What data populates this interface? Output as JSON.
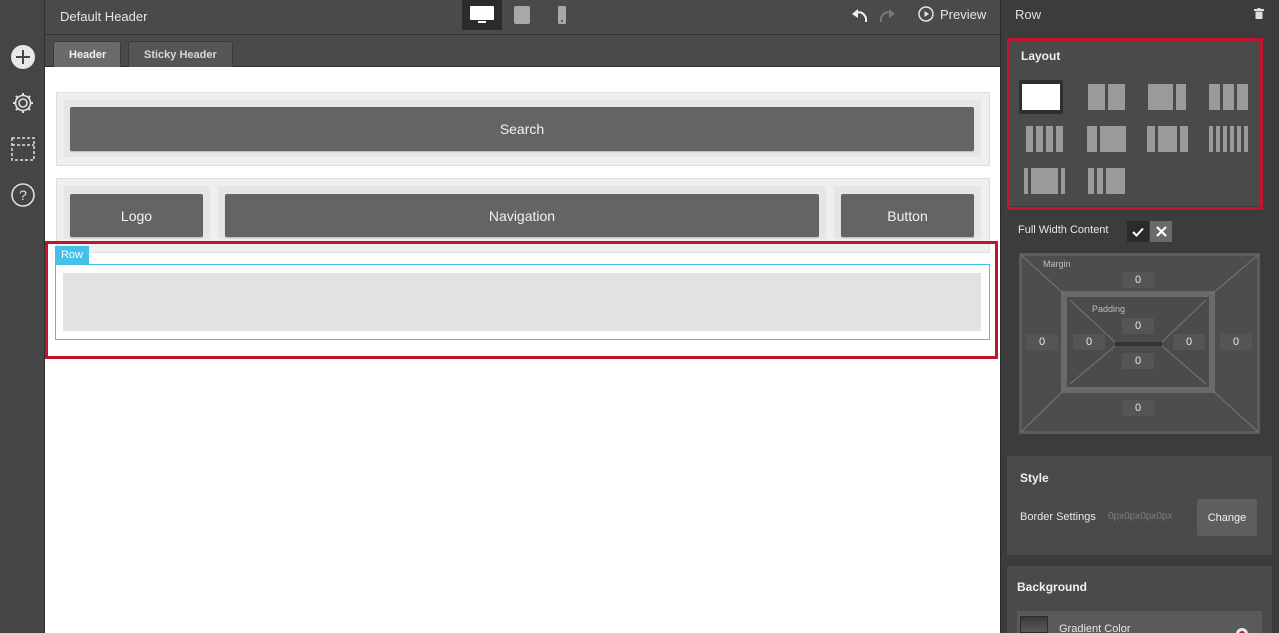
{
  "header": {
    "title": "Default Header",
    "preview_label": "Preview",
    "devices": [
      "desktop",
      "tablet",
      "mobile"
    ],
    "active_device": "desktop"
  },
  "tabs": [
    {
      "label": "Header",
      "active": true
    },
    {
      "label": "Sticky Header",
      "active": false
    }
  ],
  "canvas": {
    "modules": {
      "search": "Search",
      "logo": "Logo",
      "navigation": "Navigation",
      "button": "Button"
    },
    "row_tag": "Row"
  },
  "rail_icons": [
    "add-icon",
    "gear-icon",
    "dashed-box-icon",
    "help-icon"
  ],
  "panel": {
    "title": "Row",
    "layout": {
      "title": "Layout",
      "selected_index": 0,
      "options_count": 10
    },
    "full_width": {
      "label": "Full Width Content"
    },
    "spacing": {
      "margin_label": "Margin",
      "padding_label": "Padding",
      "margin": {
        "top": "0",
        "right": "0",
        "bottom": "0",
        "left": "0"
      },
      "padding": {
        "top": "0",
        "right": "0",
        "bottom": "0",
        "left": "0"
      }
    },
    "style": {
      "title": "Style",
      "border_label": "Border Settings",
      "border_value": "0px0px0px0px",
      "change_label": "Change"
    },
    "background": {
      "title": "Background",
      "gradient_label": "Gradient Color"
    }
  },
  "colors": {
    "highlight": "#c0152f",
    "row_accent": "#43c1e8",
    "module": "#646464"
  }
}
